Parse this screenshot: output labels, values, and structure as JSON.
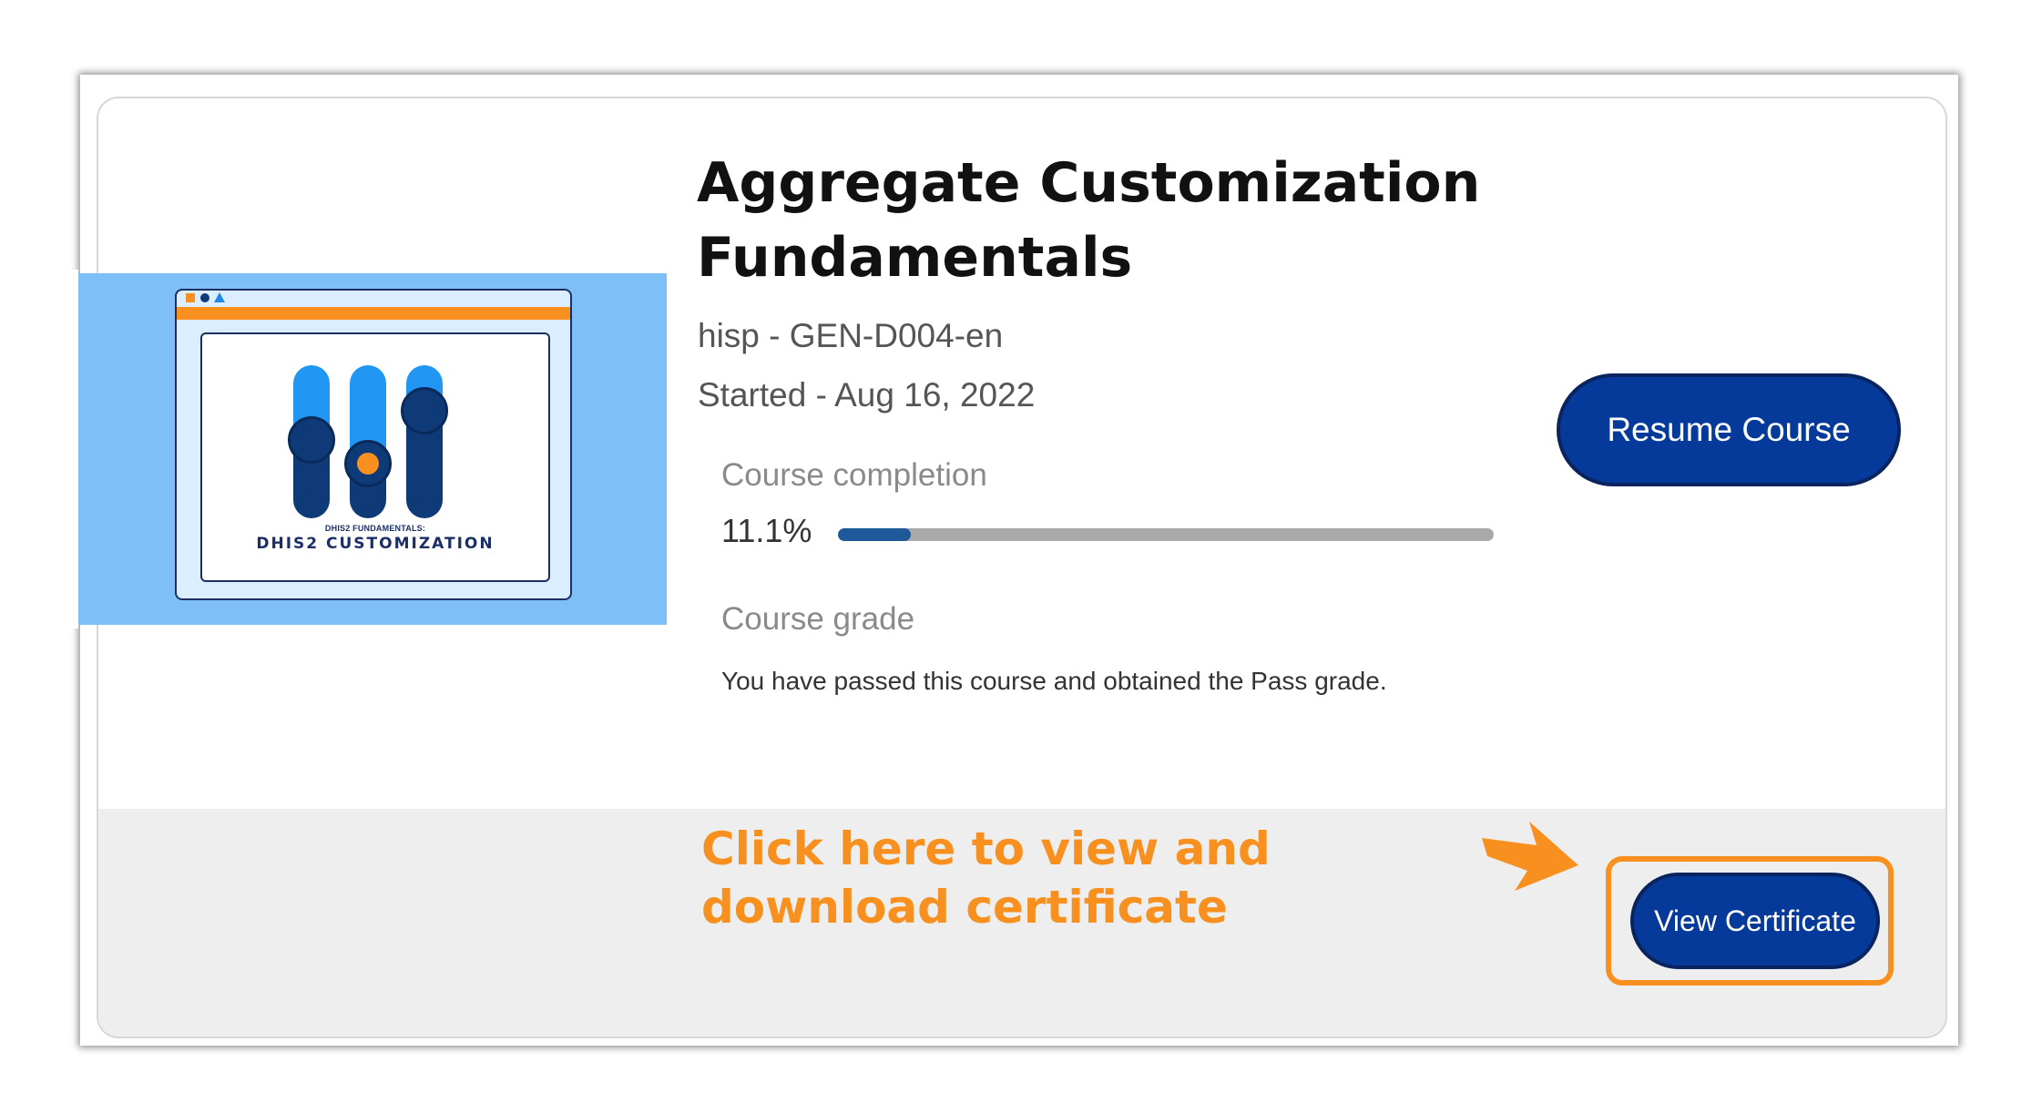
{
  "course": {
    "title": "Aggregate Customization Fundamentals",
    "code": "hisp - GEN-D004-en",
    "started": "Started - Aug 16, 2022"
  },
  "thumbnail": {
    "subtitle": "DHIS2 FUNDAMENTALS:",
    "title": "DHIS2 CUSTOMIZATION"
  },
  "completion": {
    "label": "Course completion",
    "value_text": "11.1%",
    "value": 11.1
  },
  "grade": {
    "label": "Course grade",
    "text": "You have passed this course and obtained the Pass grade."
  },
  "buttons": {
    "resume": "Resume Course",
    "certificate": "View Certificate"
  },
  "annotation": {
    "callout": "Click here to view and download certificate"
  },
  "colors": {
    "primary_button": "#063a9a",
    "accent_orange": "#f7901e",
    "progress_fill": "#1e5a99",
    "progress_track": "#a9a9a9",
    "thumbnail_bg": "#7fbff8"
  },
  "icons": [
    "arrow-right-icon",
    "slider-icon"
  ]
}
